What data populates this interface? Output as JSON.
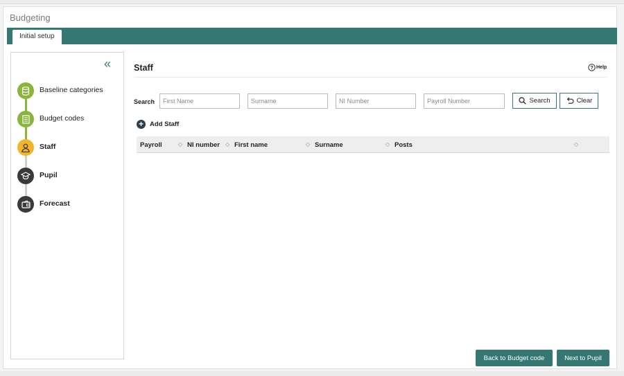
{
  "app": {
    "title": "Budgeting"
  },
  "tabs": [
    {
      "label": "Initial setup"
    }
  ],
  "sidebar": {
    "collapse_icon": "double-chevron-left-icon",
    "steps": [
      {
        "label": "Baseline categories",
        "icon": "database-icon",
        "state": "done"
      },
      {
        "label": "Budget codes",
        "icon": "document-icon",
        "state": "done"
      },
      {
        "label": "Staff",
        "icon": "person-icon",
        "state": "active"
      },
      {
        "label": "Pupil",
        "icon": "graduation-cap-icon",
        "state": "pending"
      },
      {
        "label": "Forecast",
        "icon": "wallet-icon",
        "state": "pending"
      }
    ]
  },
  "main": {
    "title": "Staff",
    "help_label": "Help",
    "search": {
      "label": "Search",
      "fields": [
        {
          "placeholder": "First Name",
          "value": ""
        },
        {
          "placeholder": "Surname",
          "value": ""
        },
        {
          "placeholder": "NI Number",
          "value": ""
        },
        {
          "placeholder": "Payroll Number",
          "value": ""
        }
      ],
      "search_button": "Search",
      "clear_button": "Clear"
    },
    "add_staff_label": "Add Staff",
    "table": {
      "columns": [
        "Payroll",
        "NI number",
        "First name",
        "Surname",
        "Posts"
      ],
      "rows": []
    },
    "back_button": "Back to Budget code",
    "next_button": "Next to Pupil"
  },
  "colors": {
    "accent": "#357873",
    "done": "#8ab43b",
    "active": "#f0b528",
    "pending": "#3a3a3a"
  }
}
